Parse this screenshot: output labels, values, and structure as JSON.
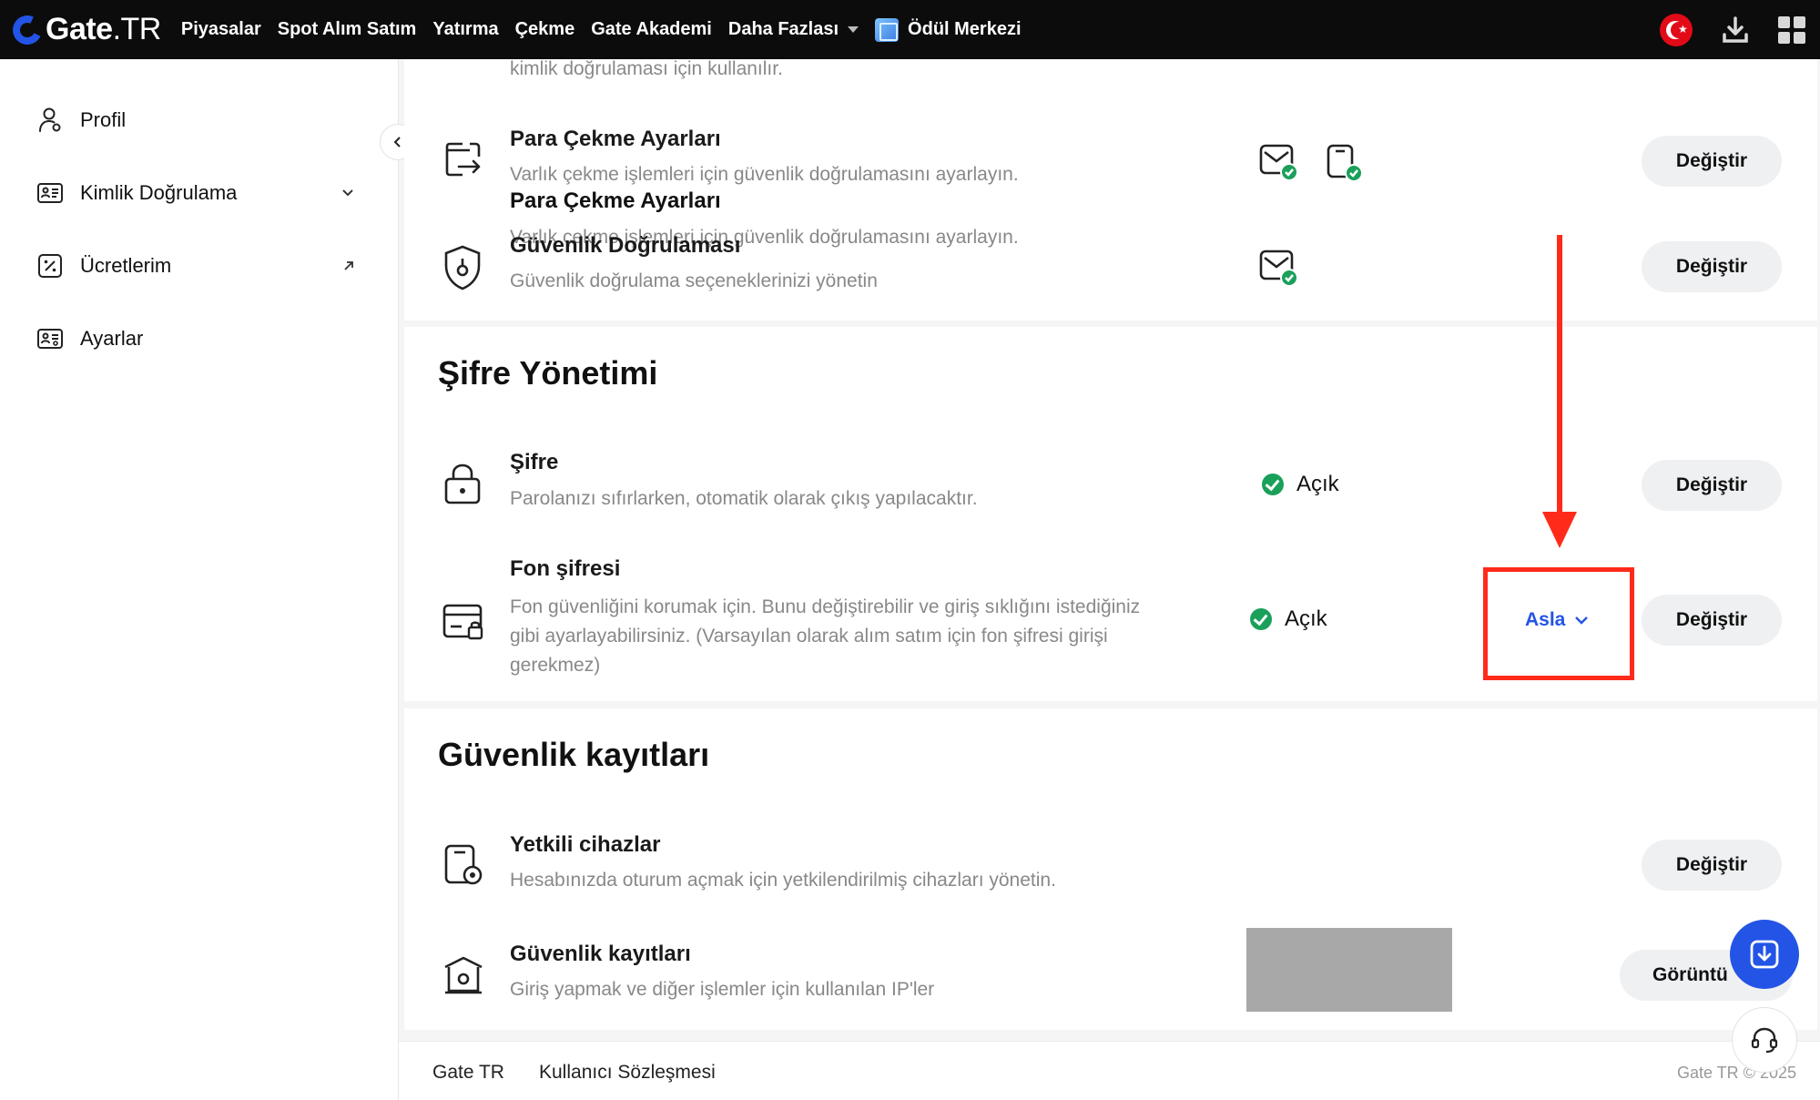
{
  "brand": {
    "name": "Gate",
    "suffix": ".TR"
  },
  "nav": {
    "links": [
      "Piyasalar",
      "Spot Alım Satım",
      "Yatırma",
      "Çekme",
      "Gate Akademi",
      "Daha Fazlası"
    ],
    "reward_center": "Ödül Merkezi"
  },
  "sidebar": {
    "items": [
      {
        "label": "Profil",
        "icon": "user-icon"
      },
      {
        "label": "Kimlik Doğrulama",
        "icon": "id-card-icon",
        "trail": "chevron-down"
      },
      {
        "label": "Ücretlerim",
        "icon": "percent-icon",
        "trail": "external-arrow"
      },
      {
        "label": "Ayarlar",
        "icon": "settings-card-icon"
      }
    ]
  },
  "top_partial_text": "kimlik doğrulaması için kullanılır.",
  "security_rows": [
    {
      "title": "Para Çekme Ayarları",
      "desc": "Varlık çekme işlemleri için güvenlik doğrulamasını ayarlayın.",
      "button": "Değiştir"
    },
    {
      "title": "Güvenlik Doğrulaması",
      "desc": "Güvenlik doğrulama seçeneklerinizi yönetin",
      "button": "Değiştir"
    }
  ],
  "password_section": {
    "title": "Şifre Yönetimi",
    "rows": [
      {
        "title": "Şifre",
        "desc": "Parolanızı sıfırlarken, otomatik olarak çıkış yapılacaktır.",
        "status": "Açık",
        "button": "Değiştir"
      },
      {
        "title": "Fon şifresi",
        "desc": "Fon güvenliğini korumak için. Bunu değiştirebilir ve giriş sıklığını istediğiniz gibi ayarlayabilirsiniz. (Varsayılan olarak alım satım için fon şifresi girişi gerekmez)",
        "status": "Açık",
        "frequency": "Asla",
        "button": "Değiştir"
      }
    ]
  },
  "logs_section": {
    "title": "Güvenlik kayıtları",
    "rows": [
      {
        "title": "Yetkili cihazlar",
        "desc": "Hesabınızda oturum açmak için yetkilendirilmiş cihazları yönetin.",
        "button": "Değiştir"
      },
      {
        "title": "Güvenlik kayıtları",
        "desc": "Giriş yapmak ve diğer işlemler için kullanılan IP'ler",
        "button": "Görüntü"
      }
    ]
  },
  "footer": {
    "links": [
      "Gate TR",
      "Kullanıcı Sözleşmesi"
    ],
    "copyright": "Gate TR © 2025"
  },
  "colors": {
    "accent": "#2354e6",
    "success": "#1aa05a",
    "annotation": "#ff2a1a"
  }
}
